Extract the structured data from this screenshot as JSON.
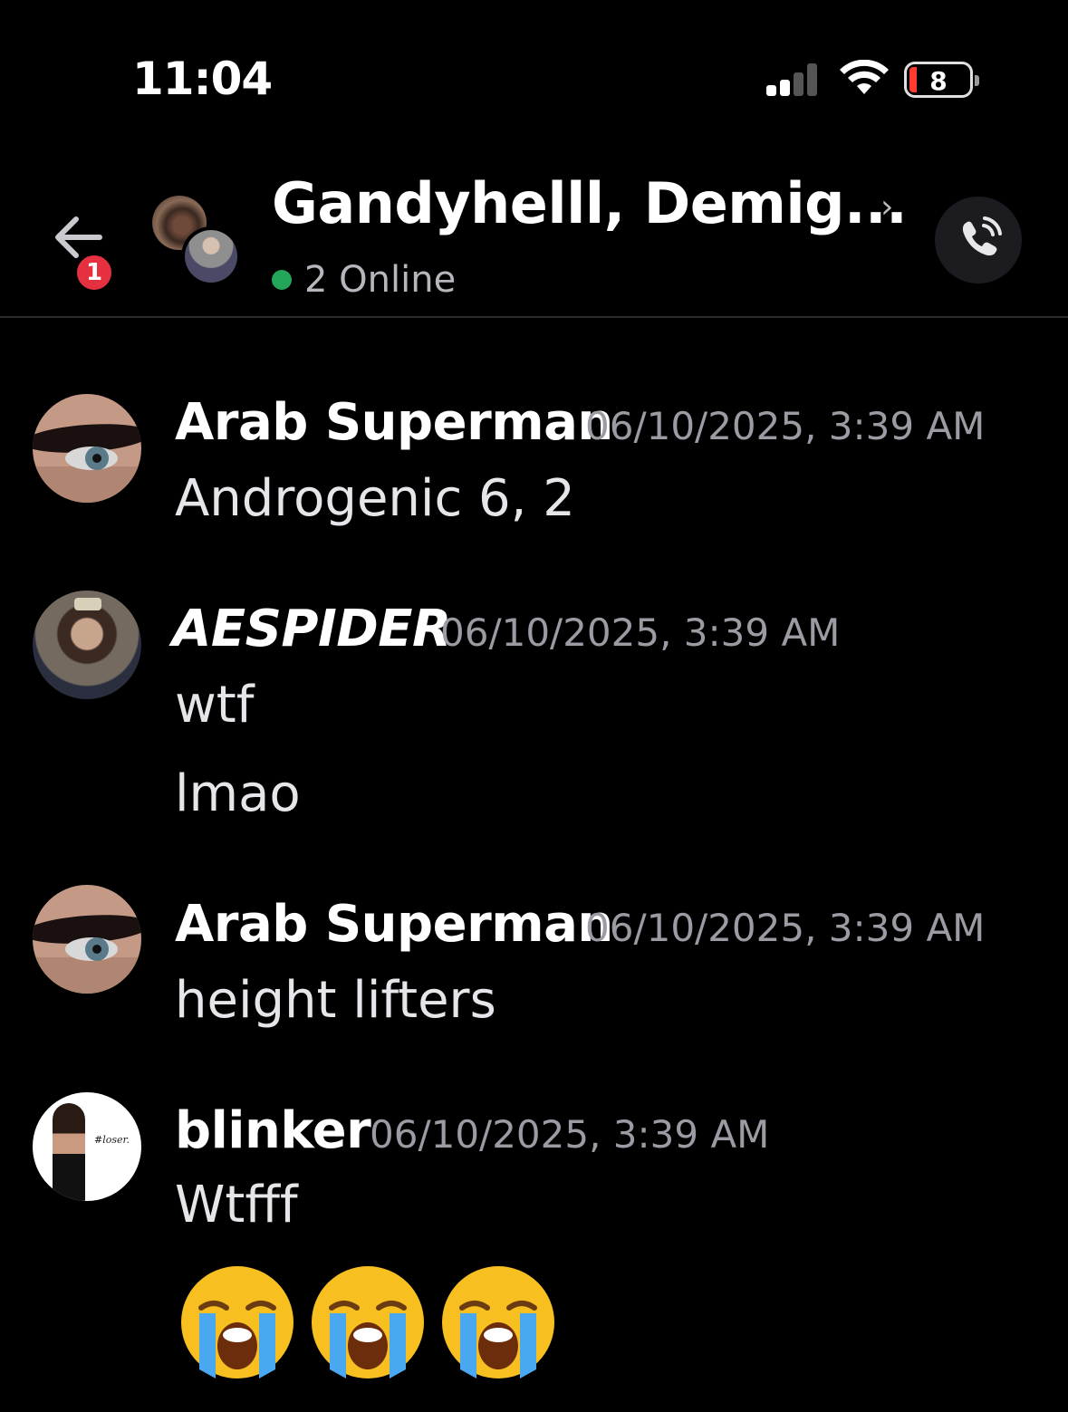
{
  "status_bar": {
    "time": "11:04",
    "battery": "8"
  },
  "header": {
    "back_badge": "1",
    "title": "Gandyhelll, Demig...",
    "chevron": "›",
    "online_status": "2 Online"
  },
  "messages": [
    {
      "author": "Arab Superman",
      "timestamp": "06/10/2025, 3:39 AM",
      "lines": [
        "Androgenic 6, 2"
      ]
    },
    {
      "author": "AESPIDER",
      "timestamp": "06/10/2025, 3:39 AM",
      "lines": [
        "wtf",
        "lmao"
      ]
    },
    {
      "author": "Arab Superman",
      "timestamp": "06/10/2025, 3:39 AM",
      "lines": [
        "height lifters"
      ]
    },
    {
      "author": "blinker",
      "timestamp": "06/10/2025, 3:39 AM",
      "lines": [
        "Wtfff"
      ],
      "emojis": [
        "loudly-crying-face",
        "loudly-crying-face",
        "loudly-crying-face"
      ],
      "avatar_caption": "#loser."
    }
  ],
  "colors": {
    "online": "#23a55a",
    "badge": "#e5303f",
    "timestamp": "#9a9ba3"
  }
}
